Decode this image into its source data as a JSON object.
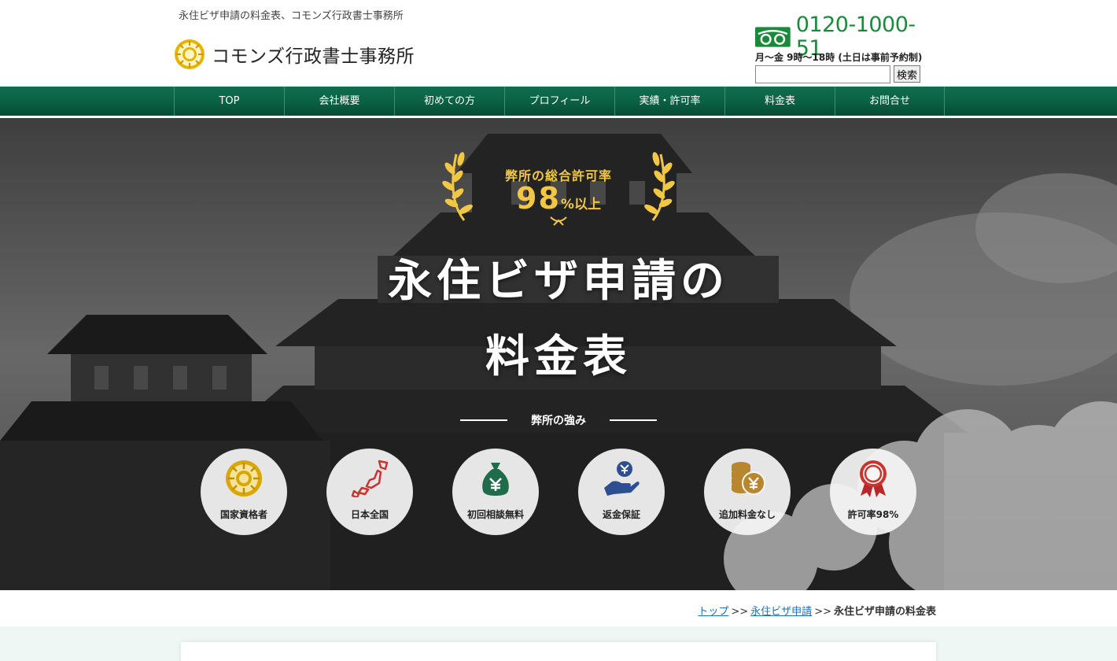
{
  "header": {
    "tagline": "永住ビザ申請の料金表、コモンズ行政書士事務所",
    "office_name": "コモンズ行政書士事務所",
    "phone": "0120-1000-51",
    "hours": "月〜金  9時〜18時 (土日は事前予約制)",
    "search_placeholder": "",
    "search_button": "検索"
  },
  "nav": {
    "items": [
      {
        "label": "TOP"
      },
      {
        "label": "会社概要"
      },
      {
        "label": "初めての方"
      },
      {
        "label": "プロフィール"
      },
      {
        "label": "実績・許可率"
      },
      {
        "label": "料金表"
      },
      {
        "label": "お問合せ"
      }
    ]
  },
  "hero": {
    "badge_line1": "弊所の総合許可率",
    "badge_number": "98",
    "badge_suffix": "%以上",
    "title_line1": "永住ビザ申請の",
    "title_line2": "料金表",
    "strength_heading": "弊所の強み",
    "strengths": [
      {
        "label": "国家資格者",
        "icon": "gyoseishoshi-seal-icon"
      },
      {
        "label": "日本全国",
        "icon": "japan-map-icon"
      },
      {
        "label": "初回相談無料",
        "icon": "money-bag-icon"
      },
      {
        "label": "返金保証",
        "icon": "refund-hand-icon"
      },
      {
        "label": "追加料金なし",
        "icon": "coin-stack-icon"
      },
      {
        "label": "許可率98%",
        "icon": "award-rosette-icon"
      }
    ]
  },
  "breadcrumb": {
    "home": "トップ",
    "sep1": ">>",
    "parent": "永住ビザ申請",
    "sep2": ">>",
    "current": "永住ビザ申請の料金表"
  },
  "colors": {
    "nav_green": "#0b6144",
    "phone_green": "#1a8a3a",
    "gold": "#f2c744",
    "seal_gold": "#d9a700",
    "link_blue": "#1b6fb8"
  }
}
